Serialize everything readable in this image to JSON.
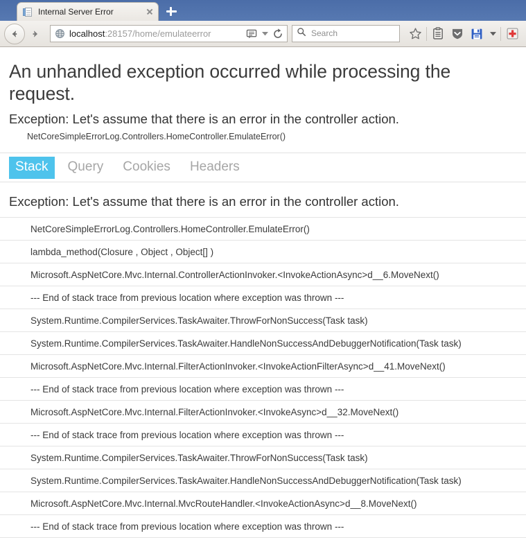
{
  "window": {
    "browser_tab": {
      "title": "Internal Server Error",
      "favicon": "page-icon",
      "close_label": "×"
    },
    "new_tab_label": "+"
  },
  "toolbar": {
    "back_label": "←",
    "forward_label": "→",
    "url_host": "localhost",
    "url_rest": ":28157/home/emulateerror",
    "reader_icon": "reader-mode-icon",
    "dropdown_icon": "chevron-down-icon",
    "reload_icon": "reload-icon",
    "search_placeholder": "Search",
    "search_icon": "search-icon",
    "bookmark_icon": "star-icon",
    "library_icon": "library-icon",
    "downloads_icon": "shield-chevron-icon",
    "save_icon": "floppy-save-icon",
    "save_dropdown_icon": "chevron-down-icon",
    "addon_icon": "red-cross-addon-icon",
    "accent_save_color": "#2f5fc4",
    "accent_addon_color": "#e03b3b"
  },
  "page": {
    "title": "An unhandled exception occurred while processing the request.",
    "subtitle": "Exception: Let's assume that there is an error in the controller action.",
    "method": "NetCoreSimpleErrorLog.Controllers.HomeController.EmulateError()",
    "tabs": [
      {
        "label": "Stack",
        "active": true
      },
      {
        "label": "Query",
        "active": false
      },
      {
        "label": "Cookies",
        "active": false
      },
      {
        "label": "Headers",
        "active": false
      }
    ],
    "active_tab_color": "#4ec3ec",
    "stack_heading": "Exception: Let's assume that there is an error in the controller action.",
    "stack_frames": [
      "NetCoreSimpleErrorLog.Controllers.HomeController.EmulateError()",
      "lambda_method(Closure , Object , Object[] )",
      "Microsoft.AspNetCore.Mvc.Internal.ControllerActionInvoker.<InvokeActionAsync>d__6.MoveNext()",
      "--- End of stack trace from previous location where exception was thrown ---",
      "System.Runtime.CompilerServices.TaskAwaiter.ThrowForNonSuccess(Task task)",
      "System.Runtime.CompilerServices.TaskAwaiter.HandleNonSuccessAndDebuggerNotification(Task task)",
      "Microsoft.AspNetCore.Mvc.Internal.FilterActionInvoker.<InvokeActionFilterAsync>d__41.MoveNext()",
      "--- End of stack trace from previous location where exception was thrown ---",
      "Microsoft.AspNetCore.Mvc.Internal.FilterActionInvoker.<InvokeAsync>d__32.MoveNext()",
      "--- End of stack trace from previous location where exception was thrown ---",
      "System.Runtime.CompilerServices.TaskAwaiter.ThrowForNonSuccess(Task task)",
      "System.Runtime.CompilerServices.TaskAwaiter.HandleNonSuccessAndDebuggerNotification(Task task)",
      "Microsoft.AspNetCore.Mvc.Internal.MvcRouteHandler.<InvokeActionAsync>d__8.MoveNext()",
      "--- End of stack trace from previous location where exception was thrown ---"
    ]
  }
}
